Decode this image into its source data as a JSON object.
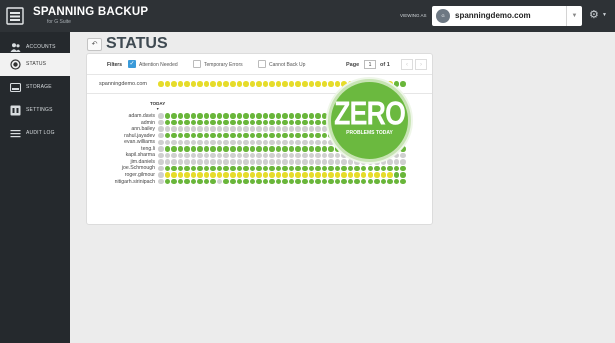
{
  "header": {
    "brand_title": "SPANNING BACKUP",
    "brand_subtitle": "for G Suite",
    "viewing_label": "VIEWING AS",
    "selected_domain": "spanningdemo.com"
  },
  "sidebar": {
    "items": [
      {
        "label": "ACCOUNTS",
        "icon": "people-icon",
        "active": false
      },
      {
        "label": "STATUS",
        "icon": "status-icon",
        "active": true
      },
      {
        "label": "STORAGE",
        "icon": "storage-icon",
        "active": false
      },
      {
        "label": "SETTINGS",
        "icon": "settings-icon",
        "active": false
      },
      {
        "label": "AUDIT LOG",
        "icon": "list-icon",
        "active": false
      }
    ]
  },
  "page": {
    "title": "STATUS"
  },
  "filters": {
    "label": "Filters",
    "options": [
      {
        "label": "Attention Needed",
        "checked": true
      },
      {
        "label": "Temporary Errors",
        "checked": false
      },
      {
        "label": "Cannot Back Up",
        "checked": false
      }
    ]
  },
  "pagination": {
    "page_label": "Page",
    "current": "1",
    "of_label": "of 1"
  },
  "domain_row": {
    "label": "spanningdemo.com",
    "cells": "yyyyyyyyyyyyyyyyyyyyyyyyyyyyyyyyyyyygg"
  },
  "grid": {
    "today_label": "TODAY",
    "users": [
      {
        "name": "adam.davis",
        "cells": "xggggggggggggggggggggggggggggggggggggg"
      },
      {
        "name": "admin",
        "cells": "xggggggggggggggggggggggggggggggggggggg"
      },
      {
        "name": "ann.bailey",
        "cells": "xxxxxxxxxxxxxxxxxxxxxxxxxxxxxxxxxxxxxx"
      },
      {
        "name": "rahul.jayadev",
        "cells": "xggggggggggggggggggggggggggggggggggggg"
      },
      {
        "name": "evan.williams",
        "cells": "xxxxxxxxxxxxxxxxxxxxxxxxxxxxxxxxxxxxxx"
      },
      {
        "name": "teng.li",
        "cells": "xggggggggggggggggggggggggggggggggggggg"
      },
      {
        "name": "kapil.sharma",
        "cells": "xxxxxxxxxxxxxxxxxxxxxxxxxxxxxxxxxxxxxx"
      },
      {
        "name": "jim.daniels",
        "cells": "xxxxxxxxxxxxxxxxxxxxxxxxxxxxxxxxxxxxxx"
      },
      {
        "name": "joe.Schmough",
        "cells": "xggggggggggggggggggggggggggggggggggggg"
      },
      {
        "name": "roger.gilmour",
        "cells": "xyyyyyyyyyyyyyyyyyyyyyyyyyyyyyyyyyyygg"
      },
      {
        "name": "nitigarh.sirinipach",
        "cells": "xggggggggxgggggggggggggggggggggggggggg"
      }
    ]
  },
  "badge": {
    "big": "ZERO",
    "small": "PROBLEMS TODAY"
  },
  "colors": {
    "green": "#69b63a",
    "yellow": "#e6dc2a",
    "gray": "#cfcfcf",
    "sidebar": "#25292d",
    "topbar": "#2e3236"
  }
}
